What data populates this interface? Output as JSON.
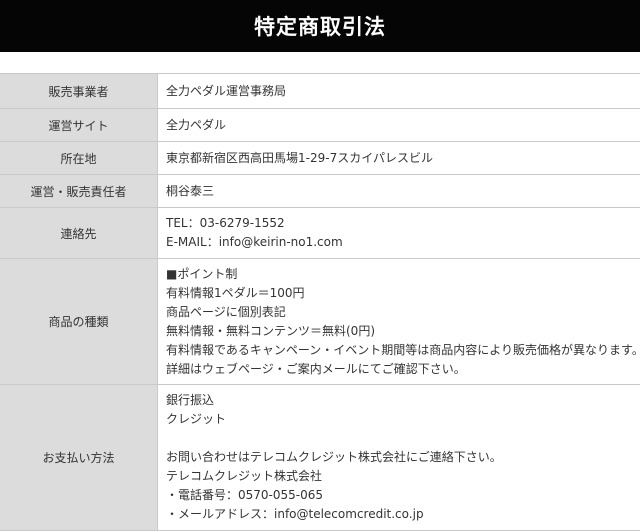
{
  "header": {
    "title": "特定商取引法"
  },
  "rows": [
    {
      "label": "販売事業者",
      "lines": [
        "全力ペダル運営事務局"
      ]
    },
    {
      "label": "運営サイト",
      "lines": [
        "全力ペダル"
      ]
    },
    {
      "label": "所在地",
      "lines": [
        "東京都新宿区西高田馬場1-29-7スカイパレスビル"
      ]
    },
    {
      "label": "運営・販売責任者",
      "lines": [
        "桐谷泰三"
      ]
    },
    {
      "label": "連絡先",
      "lines": [
        "TEL：03-6279-1552",
        "E-MAIL：info@keirin-no1.com"
      ]
    },
    {
      "label": "商品の種類",
      "lines": [
        "■ポイント制",
        "有料情報1ペダル＝100円",
        "商品ページに個別表記",
        "無料情報・無料コンテンツ＝無料(0円)",
        "有料情報であるキャンペーン・イベント期間等は商品内容により販売価格が異なります。",
        "詳細はウェブページ・ご案内メールにてご確認下さい。"
      ]
    },
    {
      "label": "お支払い方法",
      "lines": [
        "銀行振込",
        "クレジット",
        "",
        "お問い合わせはテレコムクレジット株式会社にご連絡下さい。",
        "テレコムクレジット株式会社",
        "・電話番号：0570-055-065",
        "・メールアドレス：info@telecomcredit.co.jp"
      ]
    }
  ]
}
